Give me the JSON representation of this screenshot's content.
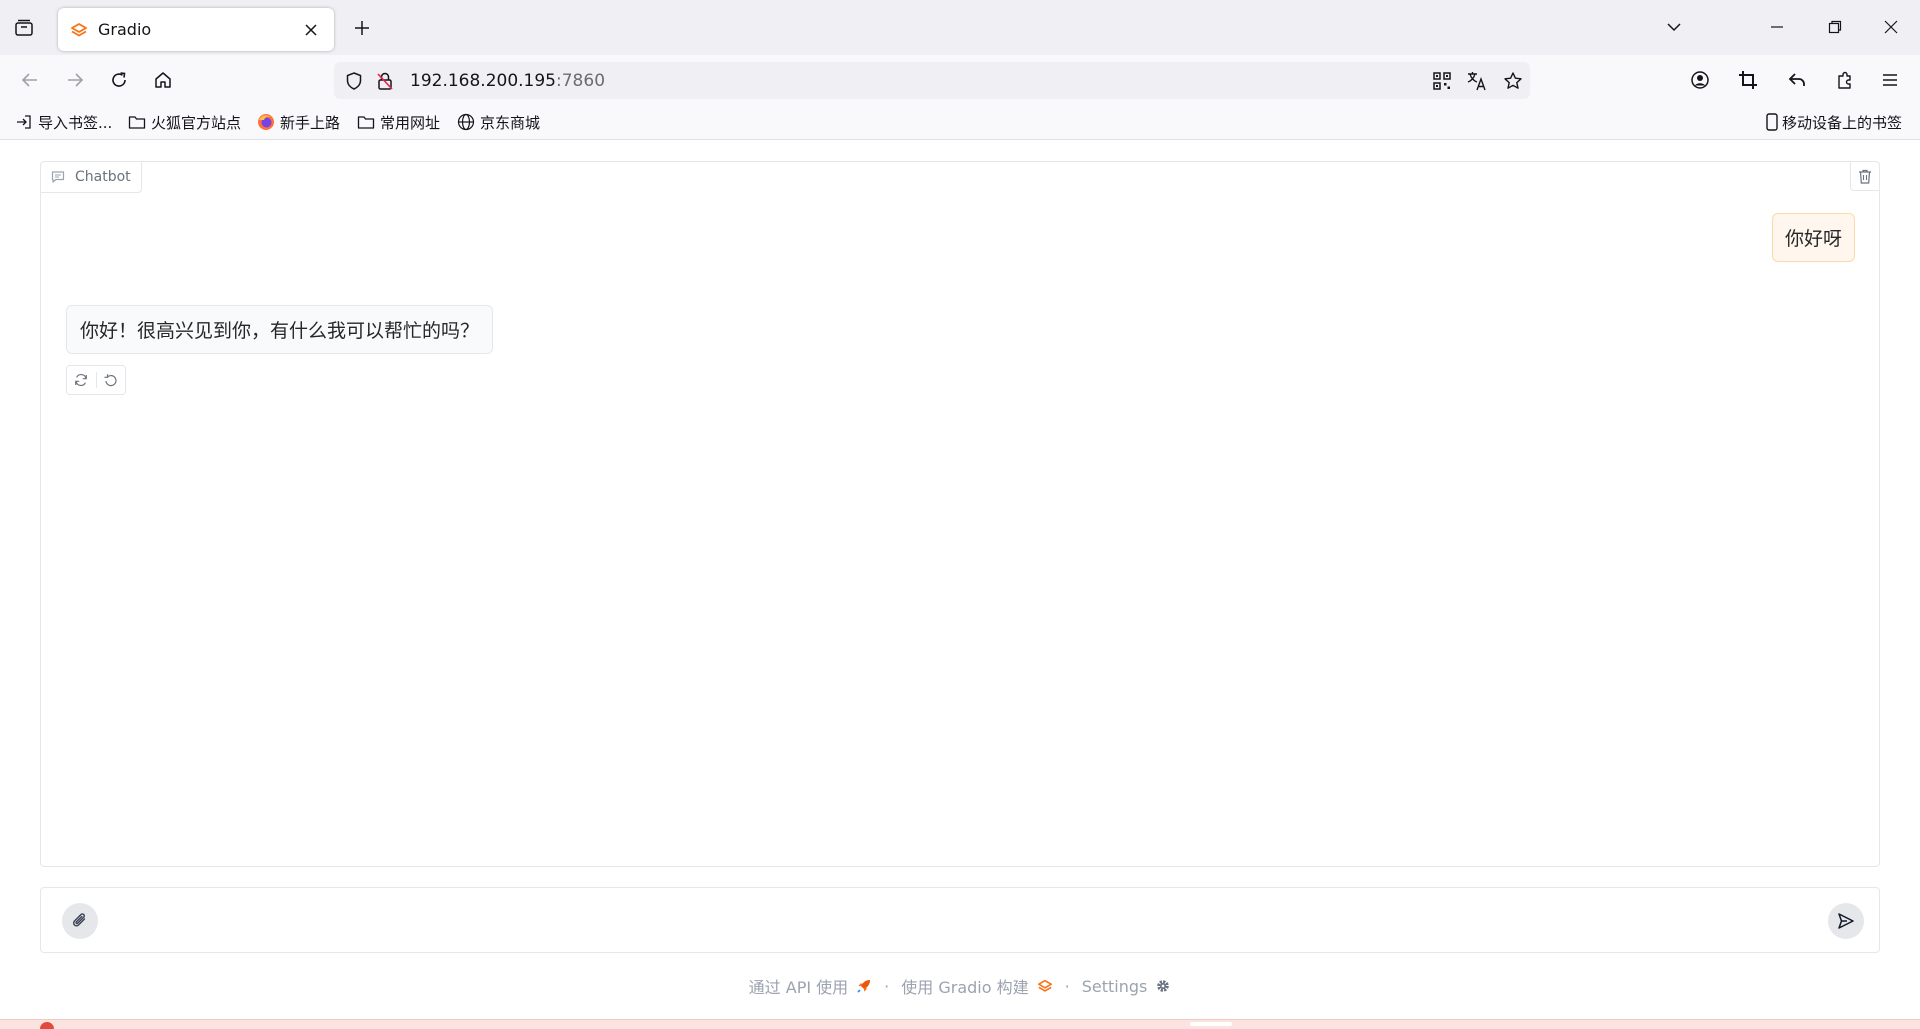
{
  "browser": {
    "tab_title": "Gradio",
    "url_host": "192.168.200.195",
    "url_port": ":7860"
  },
  "bookmarks": [
    {
      "label": "导入书签...",
      "icon": "import-icon"
    },
    {
      "label": "火狐官方站点",
      "icon": "folder-icon"
    },
    {
      "label": "新手上路",
      "icon": "firefox-icon"
    },
    {
      "label": "常用网址",
      "icon": "folder-icon"
    },
    {
      "label": "京东商城",
      "icon": "globe-icon"
    }
  ],
  "mobile_bookmarks": "移动设备上的书签",
  "chatbot": {
    "label": "Chatbot",
    "messages": [
      {
        "role": "user",
        "text": "你好呀"
      },
      {
        "role": "assistant",
        "text": "你好！很高兴见到你，有什么我可以帮忙的吗？"
      }
    ]
  },
  "input": {
    "value": "",
    "placeholder": ""
  },
  "footer": {
    "api_link": "通过 API 使用",
    "built_with": "使用 Gradio 构建",
    "settings": "Settings",
    "separator": "·"
  },
  "colors": {
    "accent": "#f97316",
    "user_bubble": "#fff7ed",
    "bot_bubble": "#f9fafb"
  }
}
